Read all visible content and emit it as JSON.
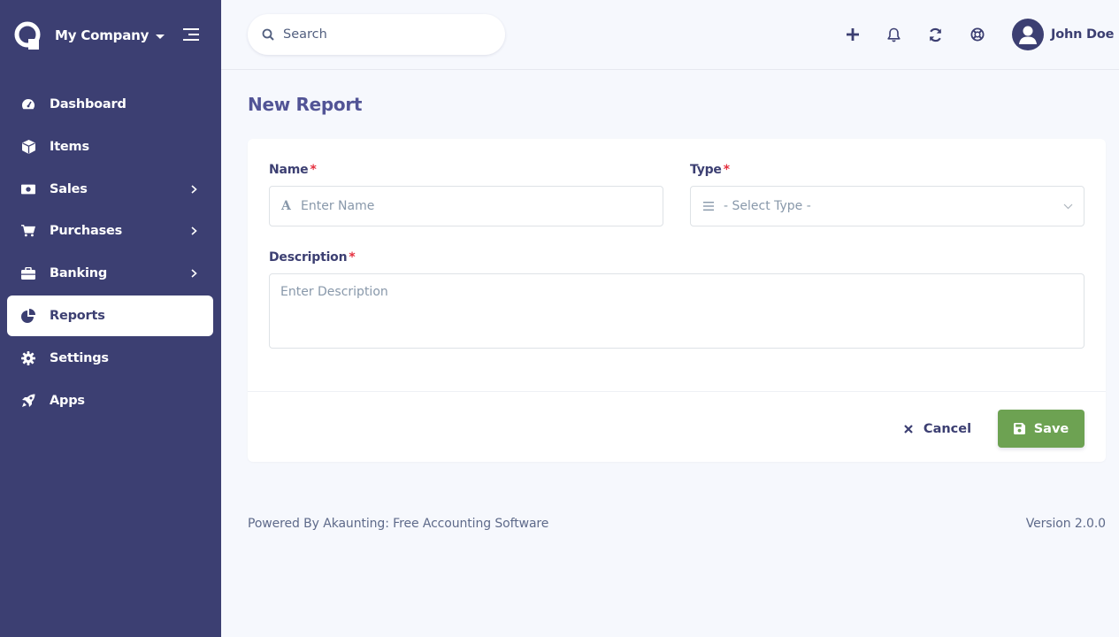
{
  "sidebar": {
    "company_name": "My Company",
    "items": [
      {
        "label": "Dashboard",
        "icon": "tachometer-icon",
        "has_submenu": false
      },
      {
        "label": "Items",
        "icon": "cube-icon",
        "has_submenu": false
      },
      {
        "label": "Sales",
        "icon": "money-bill-icon",
        "has_submenu": true
      },
      {
        "label": "Purchases",
        "icon": "shopping-cart-icon",
        "has_submenu": true
      },
      {
        "label": "Banking",
        "icon": "briefcase-icon",
        "has_submenu": true
      },
      {
        "label": "Reports",
        "icon": "chart-pie-icon",
        "has_submenu": false,
        "active": true
      },
      {
        "label": "Settings",
        "icon": "cog-icon",
        "has_submenu": false
      },
      {
        "label": "Apps",
        "icon": "rocket-icon",
        "has_submenu": false
      }
    ]
  },
  "topbar": {
    "search_placeholder": "Search",
    "user_name": "John Doe"
  },
  "page": {
    "title": "New Report"
  },
  "form": {
    "name_label": "Name",
    "name_placeholder": "Enter Name",
    "type_label": "Type",
    "type_placeholder": "- Select Type -",
    "description_label": "Description",
    "description_placeholder": "Enter Description",
    "required_mark": "*",
    "cancel_label": "Cancel",
    "save_label": "Save"
  },
  "footer": {
    "powered_by": "Powered By Akaunting: Free Accounting Software",
    "version": "Version 2.0.0"
  },
  "colors": {
    "sidebar_bg": "#3c3f72",
    "page_bg": "#f6f8fd",
    "save_button": "#6da252",
    "required": "#e5303f"
  }
}
